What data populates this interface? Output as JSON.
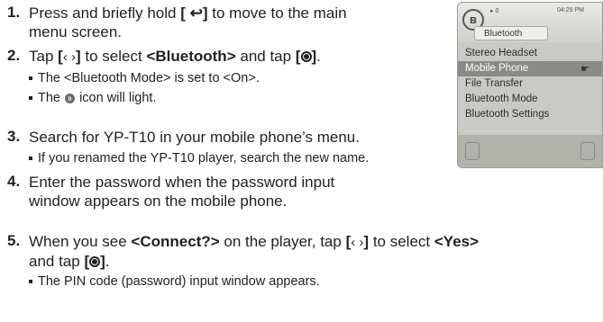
{
  "steps": [
    {
      "num": "1.",
      "line1": "Press and briefly hold",
      "key1": "[",
      "key1_end": "]",
      "line1_rest": "to move to the main",
      "line2": "menu screen."
    },
    {
      "num": "2.",
      "pre": "Tap",
      "bracket_open": "[",
      "bracket_close": "]",
      "mid": "to select",
      "target": "<Bluetooth>",
      "and": "and tap",
      "subs": [
        "The <Bluetooth Mode> is set to <On>.",
        "The",
        "icon will light."
      ]
    },
    {
      "num": "3.",
      "text": "Search for YP-T10 in your mobile phone’s menu.",
      "subs": [
        "If you renamed the YP-T10 player, search the new name."
      ]
    },
    {
      "num": "4.",
      "line1": "Enter the password when the password input",
      "line2": "window appears on the mobile phone."
    },
    {
      "num": "5.",
      "pre": "When you see",
      "target": "<Connect?>",
      "mid": "on the player, tap",
      "mid2": "to select",
      "target2": "<Yes>",
      "line2_pre": "and tap",
      "subs": [
        "The PIN code (password) input window appears."
      ]
    }
  ],
  "device": {
    "status_left": "▸ 0",
    "time": "04:29 PM",
    "title": "Bluetooth",
    "items": [
      "Stereo Headset",
      "Mobile Phone",
      "File Transfer",
      "Bluetooth Mode",
      "Bluetooth Settings"
    ],
    "selected_index": 1
  },
  "icons": {
    "back": "back-arrow-icon",
    "left_right": "left-right-icon",
    "select": "select-button-icon",
    "bluetooth": "bluetooth-icon",
    "hand": "hand-pointer-icon"
  },
  "glyphs": {
    "back": "↩",
    "lr": "‹ ›",
    "bt": "ʙ",
    "bt_big": "ʙ",
    "hand": "☛"
  }
}
